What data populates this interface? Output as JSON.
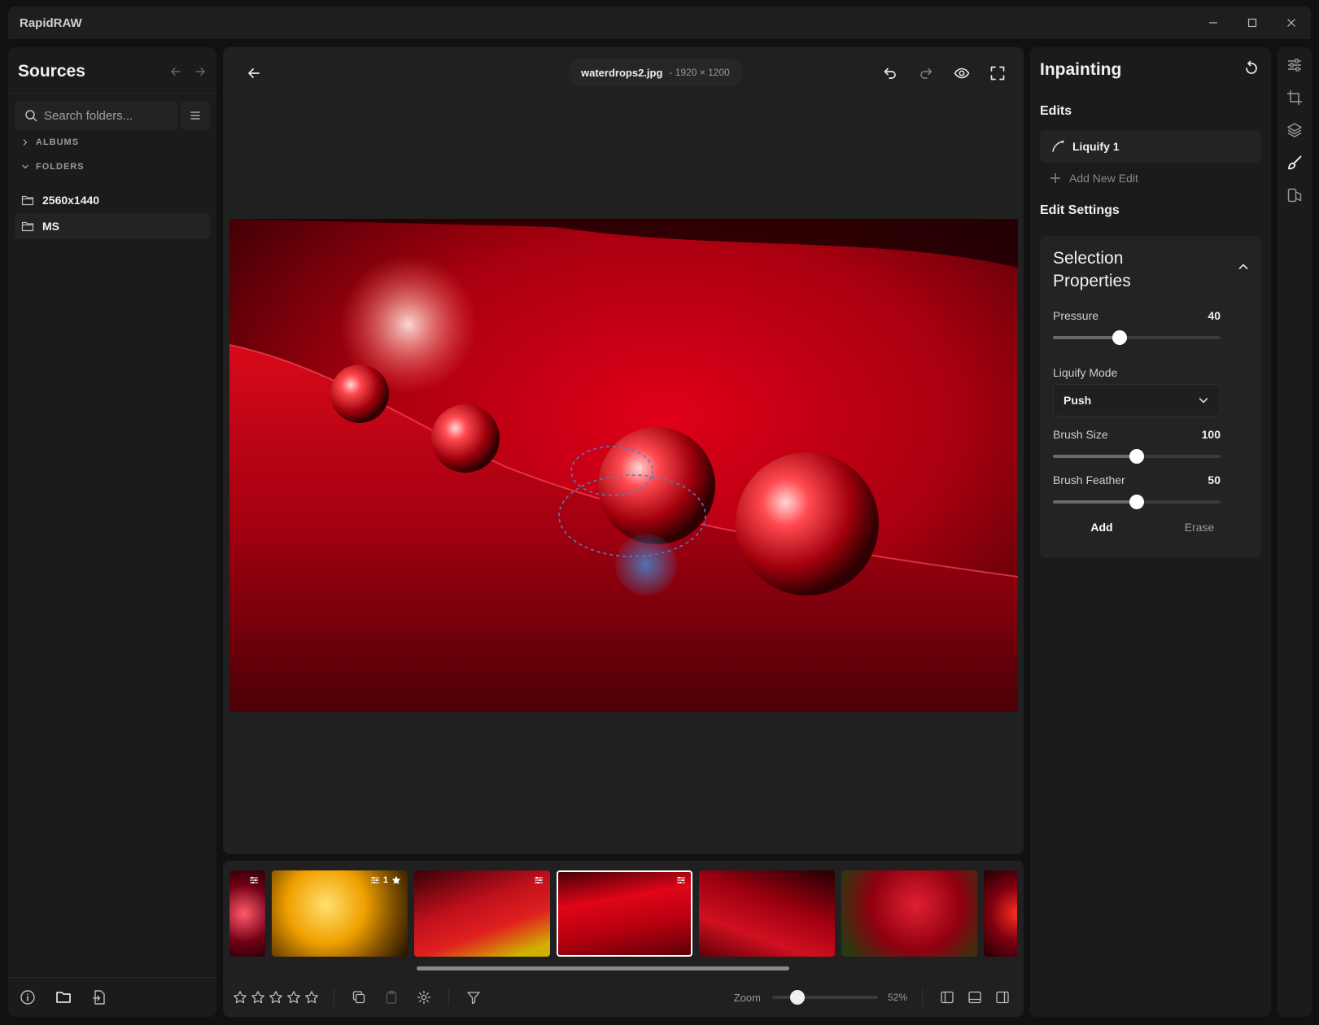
{
  "app": {
    "title": "RapidRAW"
  },
  "sources": {
    "title": "Sources",
    "search_placeholder": "Search folders...",
    "sections": {
      "albums": "ALBUMS",
      "folders": "FOLDERS"
    },
    "folders": [
      {
        "label": "2560x1440",
        "selected": false
      },
      {
        "label": "MS",
        "selected": true
      }
    ]
  },
  "viewer": {
    "file_name": "waterdrops2.jpg",
    "file_dims": "- 1920 × 1200"
  },
  "filmstrip": {
    "thumbs": [
      {
        "name": "partial-red-drops",
        "edited": true,
        "rating": "",
        "active": false
      },
      {
        "name": "yellow-bubbles",
        "edited": true,
        "rating": "1",
        "active": false
      },
      {
        "name": "red-yellow-drops",
        "edited": true,
        "rating": "",
        "active": false
      },
      {
        "name": "waterdrops2",
        "edited": true,
        "rating": "",
        "active": true
      },
      {
        "name": "red-petal-dew",
        "edited": false,
        "rating": "",
        "active": false
      },
      {
        "name": "red-leaf-drops",
        "edited": false,
        "rating": "",
        "active": false
      },
      {
        "name": "partial-red-rose",
        "edited": false,
        "rating": "",
        "active": false
      }
    ],
    "zoom_label": "Zoom",
    "zoom_value": "52%"
  },
  "inpainting": {
    "title": "Inpainting",
    "edits_heading": "Edits",
    "edit_item": "Liquify 1",
    "add_new_edit": "Add New Edit",
    "settings_heading": "Edit Settings",
    "card_title": "Selection Properties",
    "pressure": {
      "label": "Pressure",
      "value": "40"
    },
    "mode_label": "Liquify Mode",
    "mode_value": "Push",
    "brush_size": {
      "label": "Brush Size",
      "value": "100"
    },
    "brush_feather": {
      "label": "Brush Feather",
      "value": "50"
    },
    "add_label": "Add",
    "erase_label": "Erase"
  },
  "colors": {
    "accent": "#4a7fc1",
    "bg": "#111111",
    "panel": "#1b1b1b"
  }
}
